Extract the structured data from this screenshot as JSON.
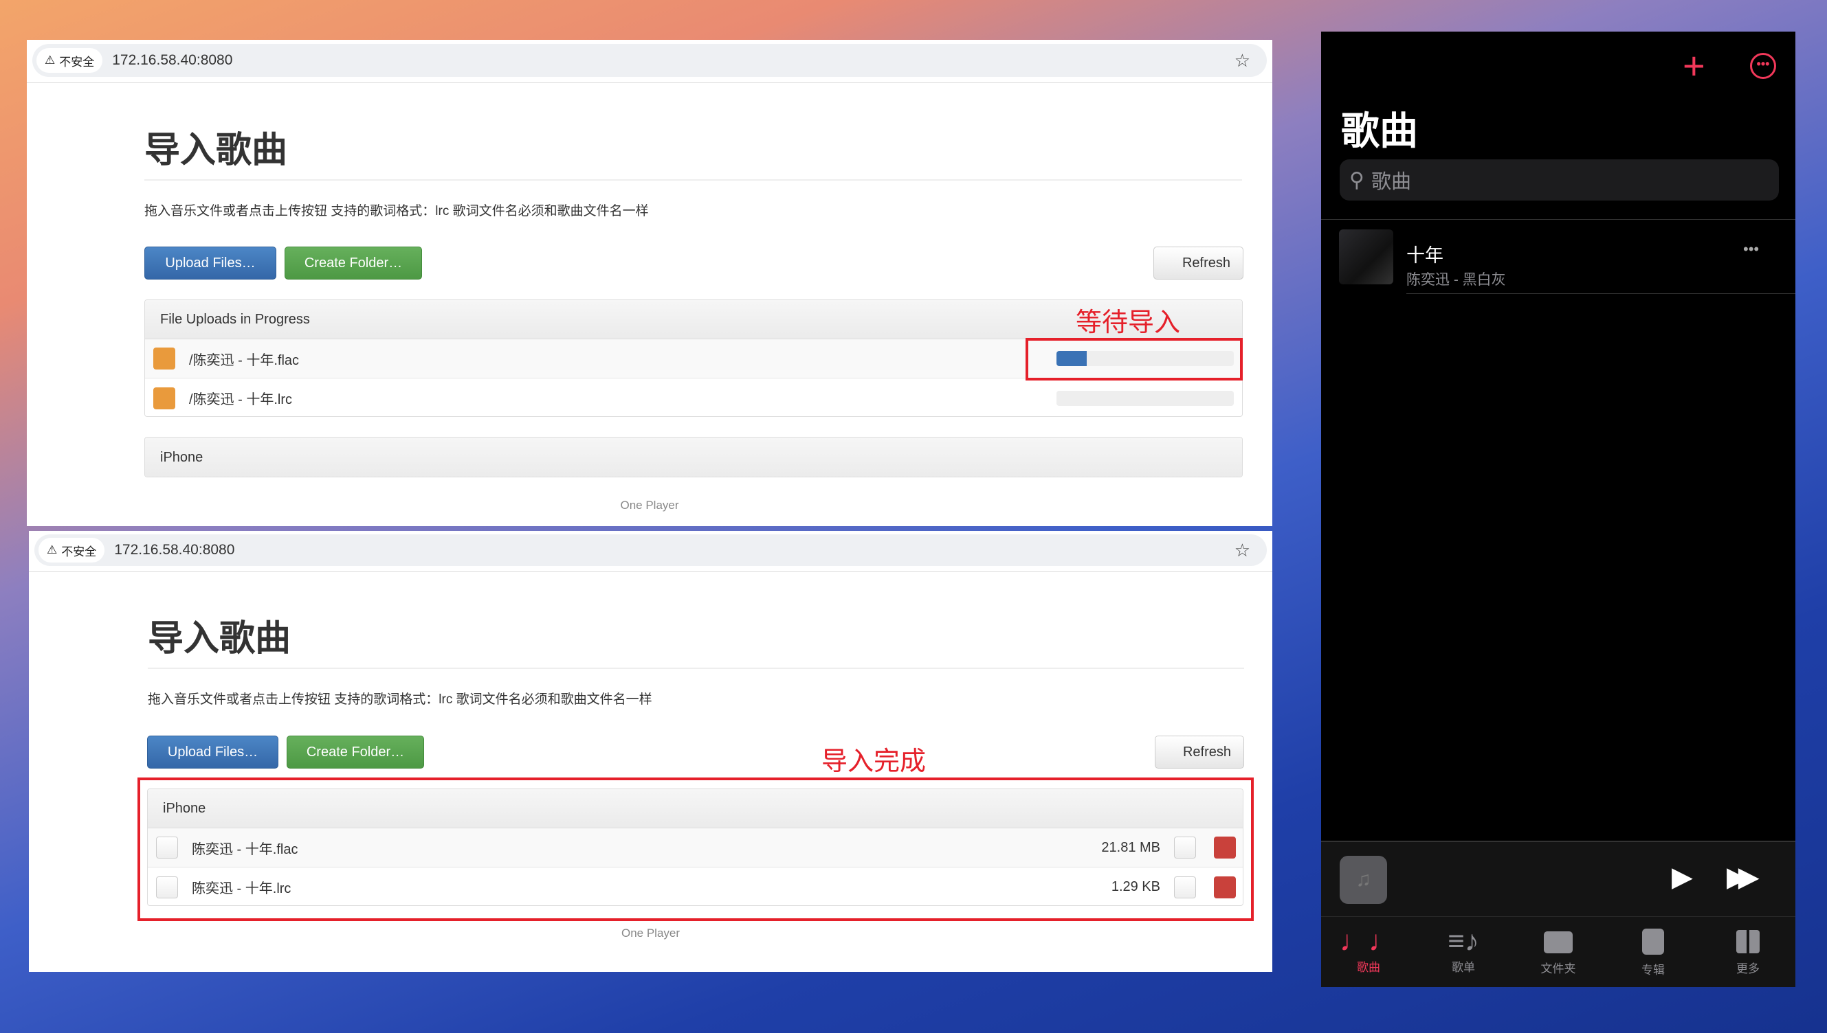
{
  "browser_top": {
    "security_label": "不安全",
    "url": "172.16.58.40:8080",
    "title": "导入歌曲",
    "description": "拖入音乐文件或者点击上传按钮 支持的歌词格式：lrc 歌词文件名必须和歌曲文件名一样",
    "upload_label": "Upload Files…",
    "create_folder_label": "Create Folder…",
    "refresh_label": "Refresh",
    "uploads_header": "File Uploads in Progress",
    "uploads": [
      {
        "name": "/陈奕迅 - 十年.flac",
        "progress": 0.17
      },
      {
        "name": "/陈奕迅 - 十年.lrc",
        "progress": 0
      }
    ],
    "folder_header": "iPhone",
    "footer": "One Player",
    "annotation": "等待导入"
  },
  "browser_bottom": {
    "security_label": "不安全",
    "url": "172.16.58.40:8080",
    "title": "导入歌曲",
    "description": "拖入音乐文件或者点击上传按钮 支持的歌词格式：lrc 歌词文件名必须和歌曲文件名一样",
    "upload_label": "Upload Files…",
    "create_folder_label": "Create Folder…",
    "refresh_label": "Refresh",
    "folder_header": "iPhone",
    "files": [
      {
        "name": "陈奕迅 - 十年.flac",
        "size": "21.81 MB"
      },
      {
        "name": "陈奕迅 - 十年.lrc",
        "size": "1.29 KB"
      }
    ],
    "footer": "One Player",
    "annotation": "导入完成"
  },
  "phone": {
    "title": "歌曲",
    "search_placeholder": "歌曲",
    "accent": "#f2385a",
    "songs": [
      {
        "title": "十年",
        "subtitle": "陈奕迅 - 黑白灰"
      }
    ],
    "tabs": [
      {
        "label": "歌曲",
        "active": true
      },
      {
        "label": "歌单"
      },
      {
        "label": "文件夹"
      },
      {
        "label": "专辑"
      },
      {
        "label": "更多"
      }
    ]
  }
}
